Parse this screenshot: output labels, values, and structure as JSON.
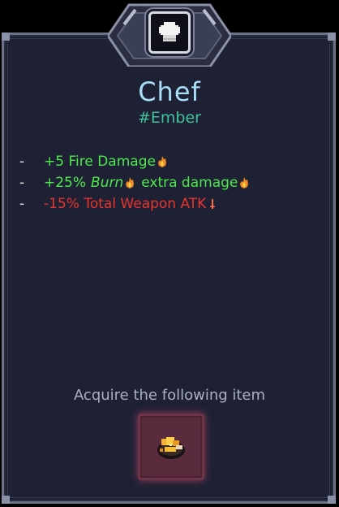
{
  "card": {
    "title": "Chef",
    "tag": "#Ember"
  },
  "stats": [
    {
      "dash": "-",
      "value": "+5 Fire Damage",
      "icon": "fire-icon"
    },
    {
      "dash": "-",
      "value": "+25%",
      "keyword": "Burn",
      "suffix": "extra damage",
      "icon": "fire-icon"
    },
    {
      "dash": "-",
      "value": "-15% Total Weapon ATK",
      "icon": "weapon-attack-icon"
    }
  ],
  "acquire": {
    "label": "Acquire the following item",
    "item_icon": "honey-item-icon"
  },
  "colors": {
    "title": "#a9dcf8",
    "tag": "#3fc29c",
    "buff": "#4ee84e",
    "debuff": "#e8332e",
    "panel": "#1e2133",
    "item_slot": "#5a2b3c"
  }
}
